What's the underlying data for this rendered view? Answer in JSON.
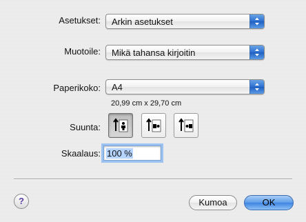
{
  "settings": {
    "label": "Asetukset:",
    "value": "Arkin asetukset"
  },
  "format_for": {
    "label": "Muotoile:",
    "value": "Mikä tahansa kirjoitin"
  },
  "paper_size": {
    "label": "Paperikoko:",
    "value": "A4",
    "dimensions": "20,99 cm x 29,70 cm"
  },
  "orientation": {
    "label": "Suunta:",
    "options": [
      "portrait",
      "landscape-left",
      "landscape-right"
    ],
    "selected": "portrait"
  },
  "scale": {
    "label": "Skaalaus:",
    "value": "100 %"
  },
  "buttons": {
    "help": "?",
    "cancel": "Kumoa",
    "ok": "OK"
  },
  "colors": {
    "accent": "#3d84e0",
    "focus_ring": "#9cc3f2"
  }
}
